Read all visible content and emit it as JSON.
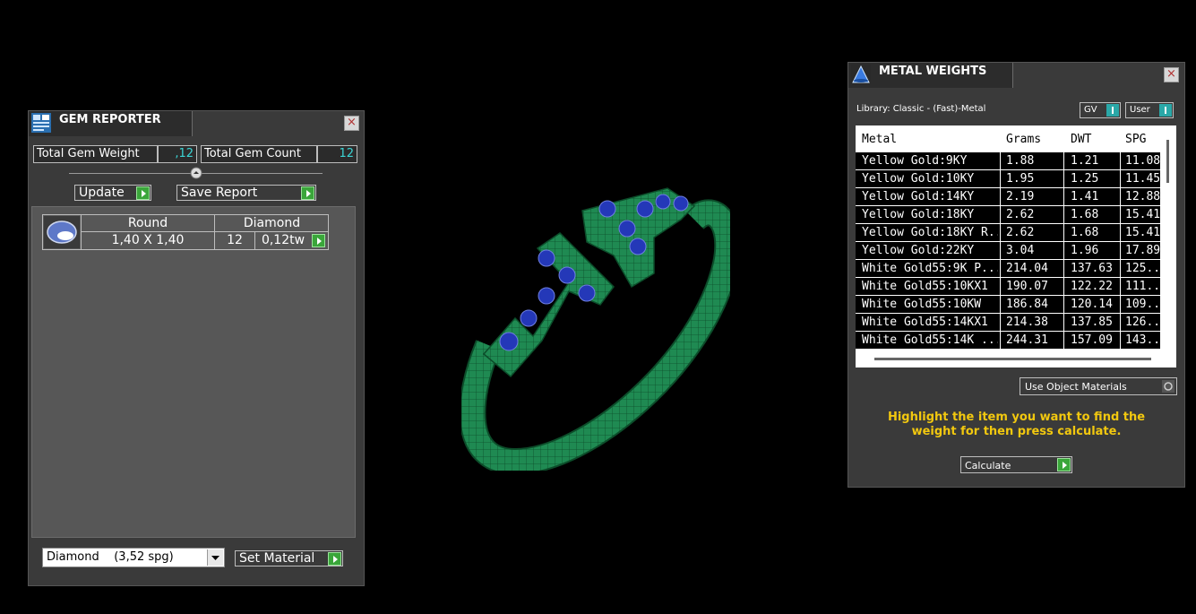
{
  "gem_reporter": {
    "title": "GEM REPORTER",
    "total_weight_label": "Total Gem Weight",
    "total_weight_value": ",12",
    "total_count_label": "Total Gem Count",
    "total_count_value": "12",
    "update_label": "Update",
    "save_report_label": "Save Report",
    "gem": {
      "shape": "Round",
      "material": "Diamond",
      "size": "1,40 X 1,40",
      "count": "12",
      "weight": "0,12tw"
    },
    "material_select": "Diamond    (3,52 spg)",
    "set_material_label": "Set Material",
    "close": "×"
  },
  "metal_weights": {
    "title": "METAL WEIGHTS",
    "library": "Library: Classic - (Fast)-Metal",
    "gv_label": "GV",
    "user_label": "User",
    "columns": [
      "Metal",
      "Grams",
      "DWT",
      "SPG"
    ],
    "rows": [
      [
        "Yellow Gold:9KY",
        "1.88",
        "1.21",
        "11.08"
      ],
      [
        "Yellow Gold:10KY",
        "1.95",
        "1.25",
        "11.45"
      ],
      [
        "Yellow Gold:14KY",
        "2.19",
        "1.41",
        "12.88"
      ],
      [
        "Yellow Gold:18KY",
        "2.62",
        "1.68",
        "15.41"
      ],
      [
        "Yellow Gold:18KY R...",
        "2.62",
        "1.68",
        "15.41"
      ],
      [
        "Yellow Gold:22KY",
        "3.04",
        "1.96",
        "17.89"
      ],
      [
        "White Gold55:9K P...",
        "214.04",
        "137.63",
        "125..."
      ],
      [
        "White Gold55:10KX1",
        "190.07",
        "122.22",
        "111..."
      ],
      [
        "White Gold55:10KW",
        "186.84",
        "120.14",
        "109..."
      ],
      [
        "White Gold55:14KX1",
        "214.38",
        "137.85",
        "126..."
      ],
      [
        "White Gold55:14K ...",
        "244.31",
        "157.09",
        "143..."
      ]
    ],
    "use_object_materials": "Use Object Materials",
    "instructions": "Highlight the item you want to find the weight for then press calculate.",
    "calculate_label": "Calculate",
    "close": "×"
  },
  "colors": {
    "ring_green": "#1f8a52",
    "gem_blue": "#2438b8",
    "instruction_yellow": "#f2c80f",
    "value_cyan": "#3bd6d6"
  }
}
